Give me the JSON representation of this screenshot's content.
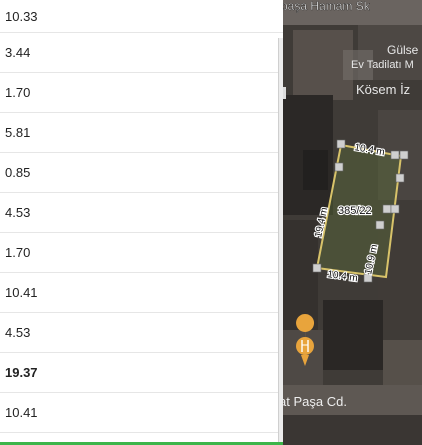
{
  "rows": [
    {
      "value": "10.33",
      "bold": false
    },
    {
      "value": "3.44",
      "bold": false
    },
    {
      "value": "1.70",
      "bold": false
    },
    {
      "value": "5.81",
      "bold": false
    },
    {
      "value": "0.85",
      "bold": false
    },
    {
      "value": "4.53",
      "bold": false
    },
    {
      "value": "1.70",
      "bold": false
    },
    {
      "value": "10.41",
      "bold": false
    },
    {
      "value": "4.53",
      "bold": false
    },
    {
      "value": "19.37",
      "bold": true
    },
    {
      "value": "10.41",
      "bold": false
    }
  ],
  "map": {
    "labels": {
      "top_street": "paşa Hamam Sk",
      "gulse": "Gülse",
      "ev_tadilat": "Ev Tadilatı M",
      "kosem": "Kösem İz",
      "bottom_street": "at Paşa Cd."
    },
    "parcel": {
      "id": "385/22",
      "edge_top": "10.4 m",
      "edge_left": "19.4 m",
      "edge_right": "10.9 m",
      "edge_bottom": "10.4 m"
    },
    "marker_icon": "restaurant-icon",
    "accent_color": "#e8a43c",
    "parcel_line_color": "#d8c36a"
  },
  "colors": {
    "progress": "#3cb54a"
  }
}
